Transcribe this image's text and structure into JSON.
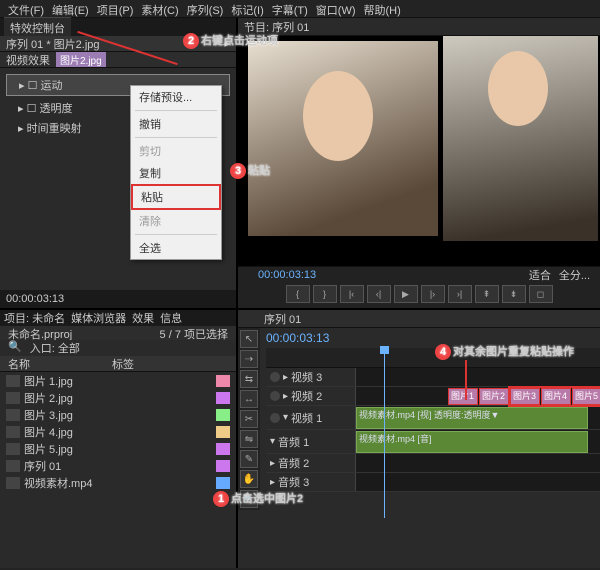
{
  "menu": {
    "file": "文件(F)",
    "edit": "编辑(E)",
    "project": "项目(P)",
    "clip": "素材(C)",
    "sequence": "序列(S)",
    "marker": "标记(I)",
    "title": "字幕(T)",
    "window": "窗口(W)",
    "help": "帮助(H)"
  },
  "effectsPanel": {
    "tab": "特效控制台",
    "sequenceRef": "序列 01 * 图片2.jpg",
    "header": "视频效果",
    "clipChip": "图片2.jpg",
    "motion": "运动",
    "opacity": "透明度",
    "timeRemap": "时间重映射",
    "tc": "00:00:03:13"
  },
  "contextMenu": {
    "savePreset": "存储预设...",
    "undo": "撤销",
    "cut": "剪切",
    "copy": "复制",
    "paste": "粘贴",
    "clear": "清除",
    "selectAll": "全选"
  },
  "programMonitor": {
    "tab": "节目: 序列 01",
    "tc": "00:00:03:13",
    "fit": "适合",
    "full": "全分..."
  },
  "projectPanel": {
    "tabs": {
      "project": "项目: 未命名",
      "mediaBrowser": "媒体浏览器",
      "effects": "效果",
      "info": "信息"
    },
    "name": "未命名.prproj",
    "count": "5 / 7 项已选择",
    "filter": "入口: 全部",
    "searchIcon": "🔍",
    "colName": "名称",
    "colLabel": "标签",
    "items": [
      {
        "name": "图片 1.jpg",
        "sw": "sw-o"
      },
      {
        "name": "图片 2.jpg",
        "sw": "sw-m"
      },
      {
        "name": "图片 3.jpg",
        "sw": "sw-g"
      },
      {
        "name": "图片 4.jpg",
        "sw": "sw-y"
      },
      {
        "name": "图片 5.jpg",
        "sw": "sw-m"
      },
      {
        "name": "序列 01",
        "sw": "sw-m"
      },
      {
        "name": "视频素材.mp4",
        "sw": "sw-b"
      }
    ]
  },
  "timeline": {
    "tab": "序列 01",
    "tc": "00:00:03:13",
    "tracks": {
      "v3": "视频 3",
      "v2": "视频 2",
      "v1": "视频 1",
      "a1": "音频 1",
      "a2": "音频 2",
      "a3": "音频 3"
    },
    "clips": {
      "img1": "图片1",
      "img2": "图片2",
      "img3": "图片3",
      "img4": "图片4",
      "img5": "图片5",
      "vidClip": "视频素材.mp4 [视] 透明度:透明度▼",
      "audClip": "视频素材.mp4 [音]"
    }
  },
  "annotations": {
    "a1": "点击选中图片2",
    "a2": "右键点击运动项",
    "a3": "粘贴",
    "a4": "对其余图片重复粘贴操作"
  },
  "chart_data": null
}
